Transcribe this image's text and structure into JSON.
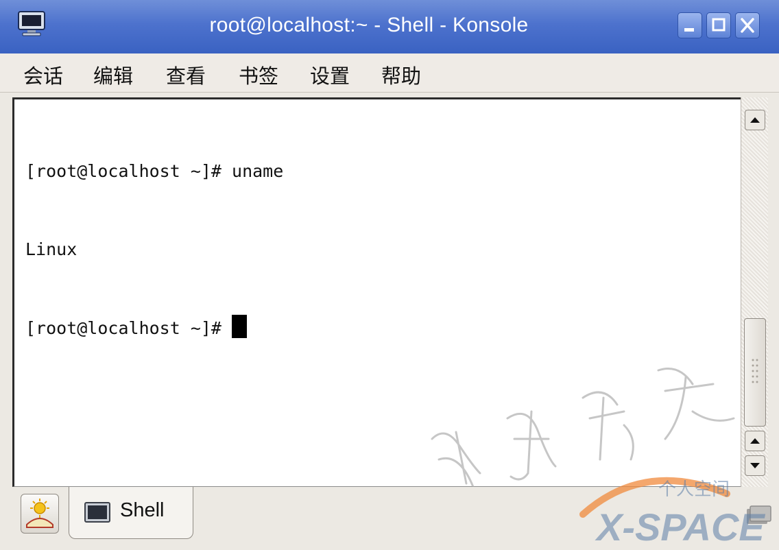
{
  "window": {
    "title": "root@localhost:~ - Shell - Konsole"
  },
  "menu": {
    "items": [
      "会话",
      "编辑",
      "查看",
      "书签",
      "设置",
      "帮助"
    ]
  },
  "terminal": {
    "lines": [
      "[root@localhost ~]# uname",
      "Linux",
      "[root@localhost ~]# "
    ]
  },
  "tabs": {
    "session_label": "Shell"
  },
  "watermark": {
    "calligraphy": "骏博科技",
    "brand_cn": "个人空间",
    "brand_en": "X-SPACE"
  },
  "icons": {
    "app": "konsole-monitor-icon",
    "minimize": "minimize-icon",
    "maximize": "maximize-icon",
    "close": "close-icon",
    "new_session": "new-session-icon",
    "tab": "terminal-tab-icon",
    "tab_close": "close-tab-icon",
    "scroll_up": "arrow-up-icon",
    "scroll_down": "arrow-down-icon"
  },
  "colors": {
    "titlebar": "#4d72cd",
    "terminal_bg": "#ffffff",
    "terminal_fg": "#111111",
    "watermark_orange": "#f08a3c",
    "watermark_blue": "#5d7fa8"
  }
}
